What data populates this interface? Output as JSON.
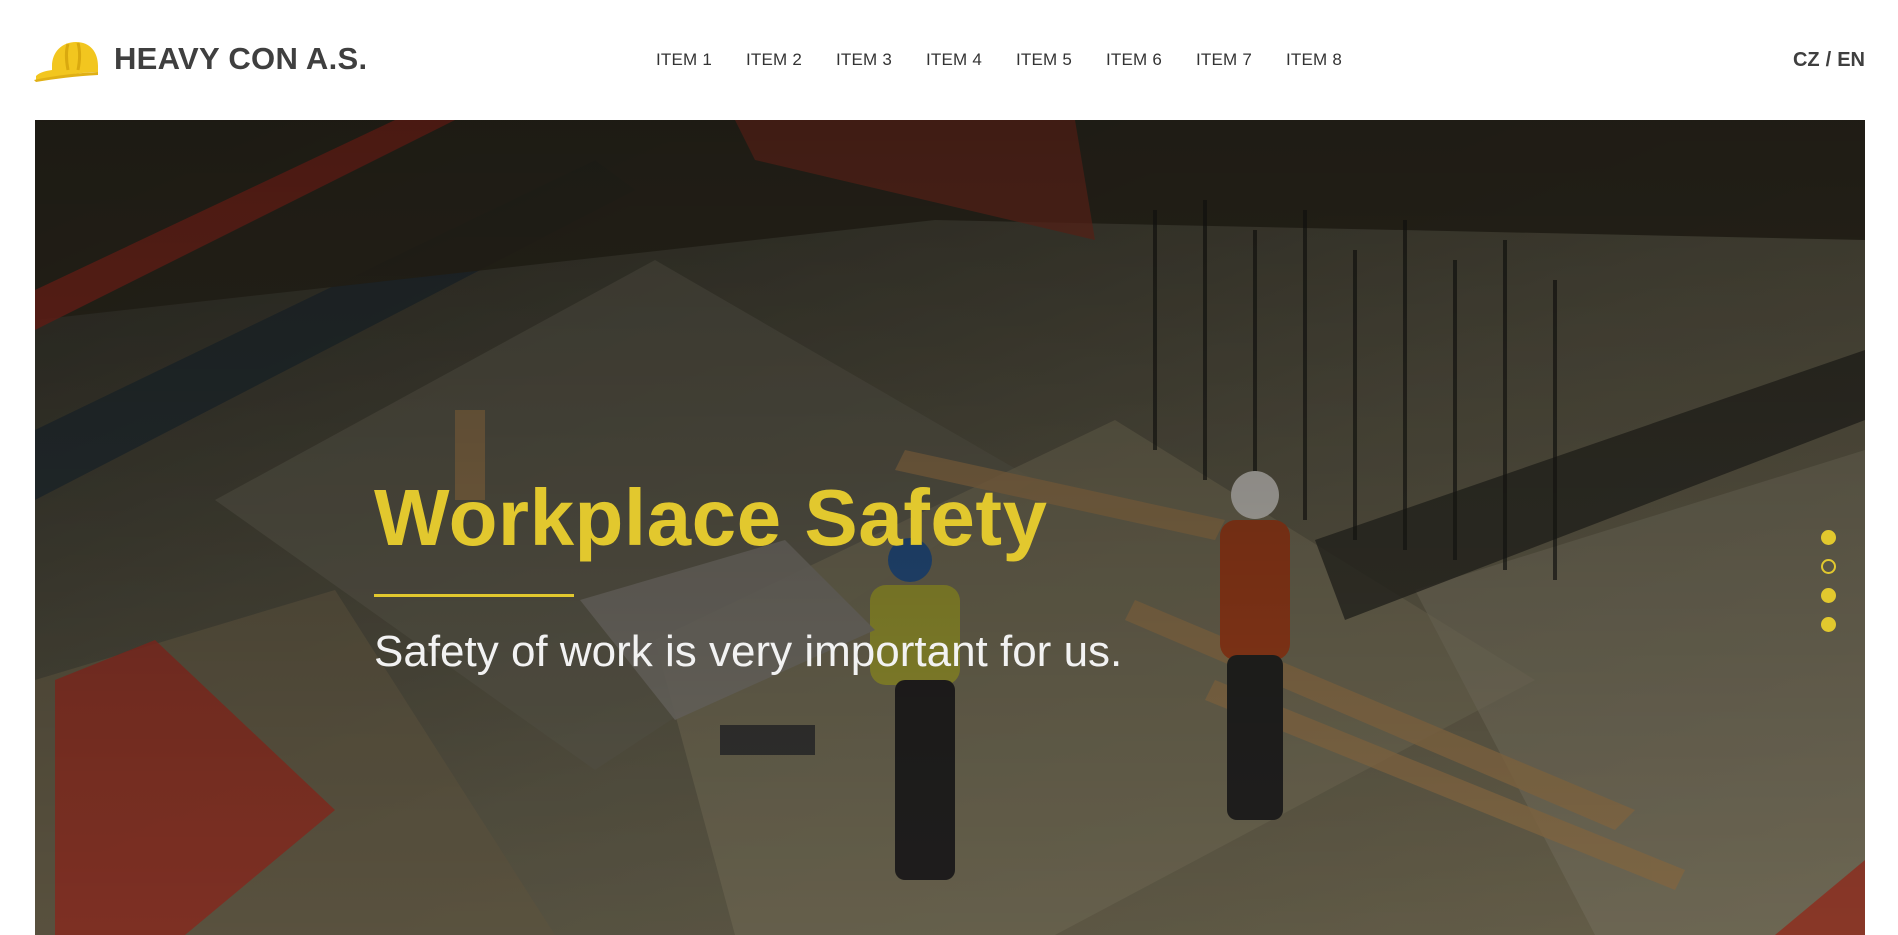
{
  "brand": {
    "name": "HEAVY CON A.S.",
    "logo_icon": "hard-hat-icon",
    "accent_color": "#f2c61f"
  },
  "nav": {
    "items": [
      {
        "label": "ITEM 1"
      },
      {
        "label": "ITEM 2"
      },
      {
        "label": "ITEM 3"
      },
      {
        "label": "ITEM 4"
      },
      {
        "label": "ITEM 5"
      },
      {
        "label": "ITEM 6"
      },
      {
        "label": "ITEM 7"
      },
      {
        "label": "ITEM 8"
      }
    ]
  },
  "language": {
    "cz": "CZ",
    "separator": "/",
    "en": "EN"
  },
  "hero": {
    "title": "Workplace Safety",
    "subtitle": "Safety of work is very important for us.",
    "title_color": "#e2c82e",
    "background": "construction-site-photo",
    "slides": [
      {
        "active": false
      },
      {
        "active": true
      },
      {
        "active": false
      },
      {
        "active": false
      }
    ]
  }
}
